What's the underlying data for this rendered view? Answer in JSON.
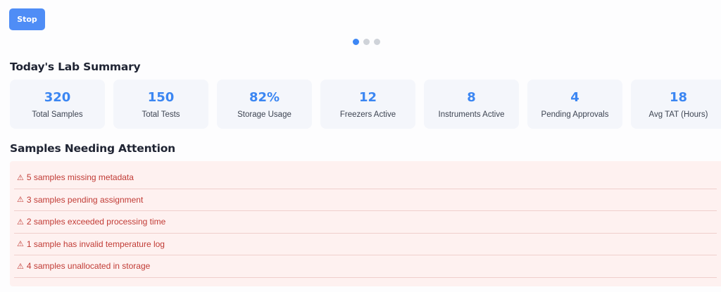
{
  "controls": {
    "stop_label": "Stop"
  },
  "carousel": {
    "pages": 3,
    "active_index": 0
  },
  "summary": {
    "title": "Today's Lab Summary",
    "cards": [
      {
        "value": "320",
        "label": "Total Samples"
      },
      {
        "value": "150",
        "label": "Total Tests"
      },
      {
        "value": "82%",
        "label": "Storage Usage"
      },
      {
        "value": "12",
        "label": "Freezers Active"
      },
      {
        "value": "8",
        "label": "Instruments Active"
      },
      {
        "value": "4",
        "label": "Pending Approvals"
      },
      {
        "value": "18",
        "label": "Avg TAT (Hours)"
      }
    ]
  },
  "attention": {
    "title": "Samples Needing Attention",
    "icon": "warning-icon",
    "icon_glyph": "⚠",
    "items": [
      "5 samples missing metadata",
      "3 samples pending assignment",
      "2 samples exceeded processing time",
      "1 sample has invalid temperature log",
      "4 samples unallocated in storage"
    ]
  },
  "colors": {
    "accent": "#3b86f2",
    "button": "#4f8df6",
    "alert_bg": "#fef1f0",
    "alert_text": "#c13b35"
  }
}
